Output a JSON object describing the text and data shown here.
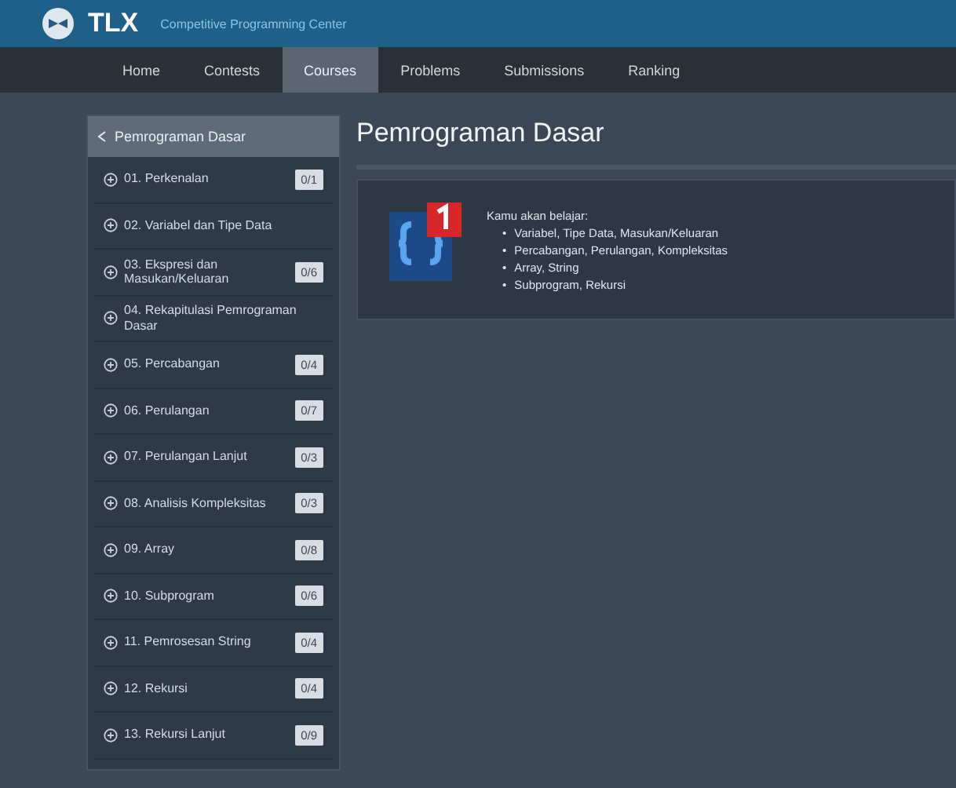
{
  "header": {
    "brand": "TLX",
    "tagline": "Competitive Programming Center"
  },
  "nav": [
    {
      "label": "Home",
      "selected": false
    },
    {
      "label": "Contests",
      "selected": false
    },
    {
      "label": "Courses",
      "selected": true
    },
    {
      "label": "Problems",
      "selected": false
    },
    {
      "label": "Submissions",
      "selected": false
    },
    {
      "label": "Ranking",
      "selected": false
    }
  ],
  "sidebar": {
    "title": "Pemrograman Dasar",
    "chapters": [
      {
        "label": "01. Perkenalan",
        "progress": "0/1"
      },
      {
        "label": "02. Variabel dan Tipe Data"
      },
      {
        "label": "03. Ekspresi dan Masukan/Keluaran",
        "progress": "0/6"
      },
      {
        "label": "04. Rekapitulasi Pemrograman Dasar"
      },
      {
        "label": "05. Percabangan",
        "progress": "0/4"
      },
      {
        "label": "06. Perulangan",
        "progress": "0/7"
      },
      {
        "label": "07. Perulangan Lanjut",
        "progress": "0/3"
      },
      {
        "label": "08. Analisis Kompleksitas",
        "progress": "0/3"
      },
      {
        "label": "09. Array",
        "progress": "0/8"
      },
      {
        "label": "10. Subprogram",
        "progress": "0/6"
      },
      {
        "label": "11. Pemrosesan String",
        "progress": "0/4"
      },
      {
        "label": "12. Rekursi",
        "progress": "0/4"
      },
      {
        "label": "13. Rekursi Lanjut",
        "progress": "0/9"
      }
    ]
  },
  "main": {
    "title": "Pemrograman Dasar",
    "intro": "Kamu akan belajar:",
    "marker": "•",
    "bullets": [
      "Variabel, Tipe Data, Masukan/Keluaran",
      "Percabangan, Perulangan, Kompleksitas",
      "Array, String",
      "Subprogram, Rekursi"
    ]
  }
}
